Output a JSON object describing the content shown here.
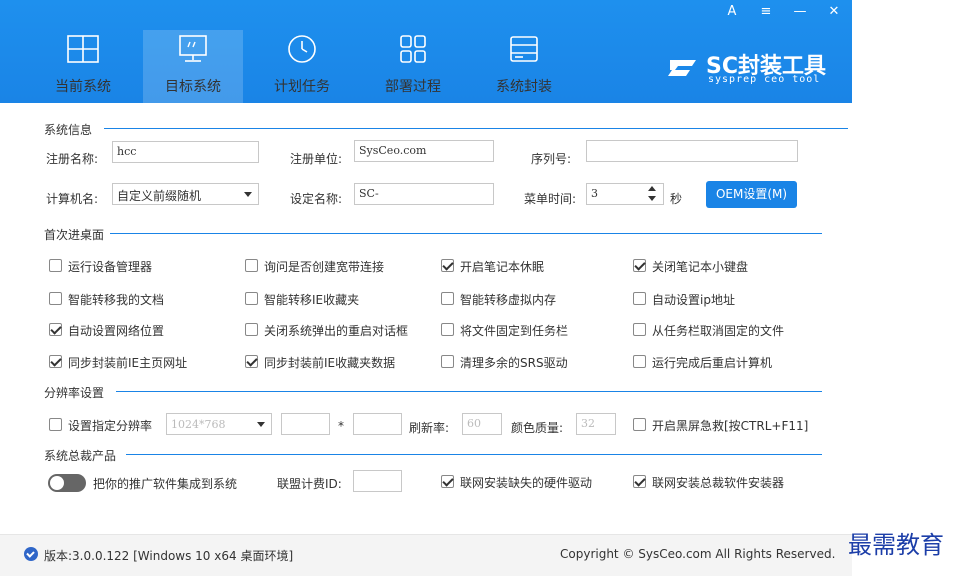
{
  "window": {
    "controls": [
      "A",
      "≡",
      "—",
      "✕"
    ]
  },
  "nav": {
    "tabs": [
      {
        "label": "当前系统",
        "icon": "windows-grid-icon",
        "active": false
      },
      {
        "label": "目标系统",
        "icon": "monitor-icon",
        "active": true
      },
      {
        "label": "计划任务",
        "icon": "clock-icon",
        "active": false
      },
      {
        "label": "部署过程",
        "icon": "grid-squares-icon",
        "active": false
      },
      {
        "label": "系统封装",
        "icon": "drive-icon",
        "active": false
      }
    ]
  },
  "logo": {
    "title": "SC封装工具",
    "subtitle": "sysprep ceo tool"
  },
  "sysinfo": {
    "section": "系统信息",
    "reg_name_label": "注册名称:",
    "reg_name_value": "hcc",
    "reg_org_label": "注册单位:",
    "reg_org_value": "SysCeo.com",
    "serial_label": "序列号:",
    "serial_value": "",
    "computer_name_label": "计算机名:",
    "computer_name_value": "自定义前缀随机",
    "set_name_label": "设定名称:",
    "set_name_value": "SC-",
    "menu_time_label": "菜单时间:",
    "menu_time_value": "3",
    "menu_time_unit": "秒",
    "oem_button": "OEM设置(M)"
  },
  "firstboot": {
    "section": "首次进桌面",
    "options": [
      {
        "label": "运行设备管理器",
        "checked": false
      },
      {
        "label": "询问是否创建宽带连接",
        "checked": false
      },
      {
        "label": "开启笔记本休眠",
        "checked": true
      },
      {
        "label": "关闭笔记本小键盘",
        "checked": true
      },
      {
        "label": "智能转移我的文档",
        "checked": false
      },
      {
        "label": "智能转移IE收藏夹",
        "checked": false
      },
      {
        "label": "智能转移虚拟内存",
        "checked": false
      },
      {
        "label": "自动设置ip地址",
        "checked": false
      },
      {
        "label": "自动设置网络位置",
        "checked": true
      },
      {
        "label": "关闭系统弹出的重启对话框",
        "checked": false
      },
      {
        "label": "将文件固定到任务栏",
        "checked": false
      },
      {
        "label": "从任务栏取消固定的文件",
        "checked": false
      },
      {
        "label": "同步封装前IE主页网址",
        "checked": true
      },
      {
        "label": "同步封装前IE收藏夹数据",
        "checked": true
      },
      {
        "label": "清理多余的SRS驱动",
        "checked": false
      },
      {
        "label": "运行完成后重启计算机",
        "checked": false
      }
    ]
  },
  "resolution": {
    "section": "分辨率设置",
    "set_res_label": "设置指定分辨率",
    "set_res_checked": false,
    "res_value": "1024*768",
    "width_value": "",
    "times": "*",
    "height_value": "",
    "refresh_label": "刷新率:",
    "refresh_value": "60",
    "color_label": "颜色质量:",
    "color_value": "32",
    "blackscreen_label": "开启黑屏急救[按CTRL+F11]",
    "blackscreen_checked": false
  },
  "products": {
    "section": "系统总裁产品",
    "promote_label": "把你的推广软件集成到系统",
    "promote_on": false,
    "alliance_label": "联盟计费ID:",
    "alliance_value": "",
    "driver_label": "联网安装缺失的硬件驱动",
    "driver_checked": true,
    "installer_label": "联网安装总裁软件安装器",
    "installer_checked": true
  },
  "footer": {
    "version": "版本:3.0.0.122 [Windows 10 x64 桌面环境]",
    "copyright": "Copyright © SysCeo.com All Rights Reserved."
  },
  "watermark": "最需教育",
  "colors": {
    "accent": "#1a84e6",
    "header": "#1e90ee"
  }
}
